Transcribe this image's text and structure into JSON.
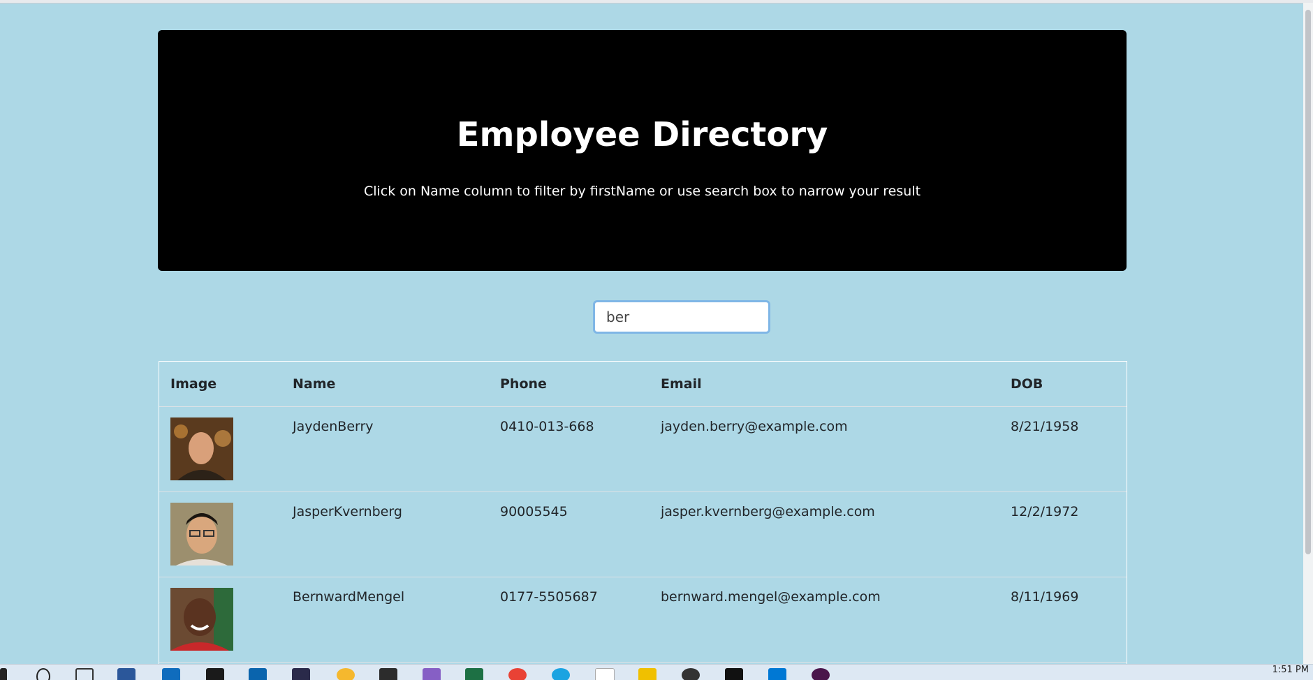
{
  "header": {
    "title": "Employee Directory",
    "subtitle": "Click on Name column to filter by firstName or use search box to narrow your result"
  },
  "search": {
    "value": "ber"
  },
  "table": {
    "columns": [
      "Image",
      "Name",
      "Phone",
      "Email",
      "DOB"
    ],
    "rows": [
      {
        "name": "JaydenBerry",
        "phone": "0410-013-668",
        "email": "jayden.berry@example.com",
        "dob": "8/21/1958"
      },
      {
        "name": "JasperKvernberg",
        "phone": "90005545",
        "email": "jasper.kvernberg@example.com",
        "dob": "12/2/1972"
      },
      {
        "name": "BernwardMengel",
        "phone": "0177-5505687",
        "email": "bernward.mengel@example.com",
        "dob": "8/11/1969"
      }
    ]
  },
  "taskbar": {
    "clock": "1:51 PM",
    "apps": [
      "windows-start-icon",
      "search-icon",
      "task-view-icon",
      "word-icon",
      "mail-icon",
      "dropbox-icon",
      "outlook-icon",
      "code-editor-icon",
      "internet-explorer-icon",
      "toolbox-icon",
      "visual-studio-icon",
      "excel-icon",
      "chrome-icon",
      "edge-icon",
      "amazon-icon",
      "file-explorer-icon",
      "obs-icon",
      "terminal-icon",
      "vscode-icon",
      "slack-icon"
    ]
  }
}
